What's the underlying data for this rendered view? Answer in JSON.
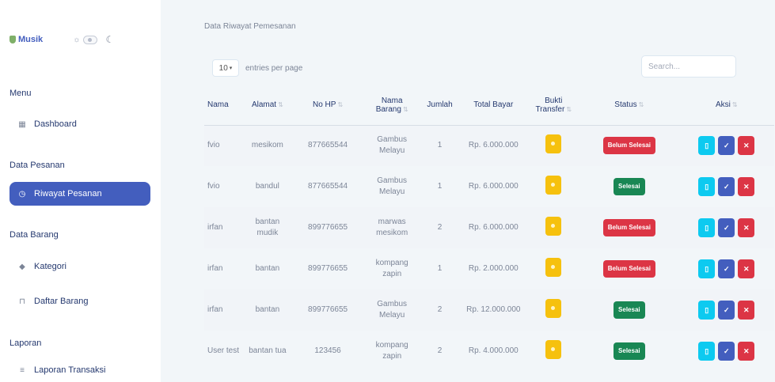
{
  "sidebar": {
    "logo_text": "Musik",
    "sections": {
      "menu": "Menu",
      "data_pesanan": "Data Pesanan",
      "data_barang": "Data Barang",
      "laporan": "Laporan"
    },
    "items": {
      "dashboard": "Dashboard",
      "riwayat_pesanan": "Riwayat Pesanan",
      "kategori": "Kategori",
      "daftar_barang": "Daftar Barang",
      "laporan_transaksi": "Laporan Transaksi"
    },
    "active_item": "riwayat_pesanan"
  },
  "main": {
    "title": "Data Riwayat Pemesanan",
    "per_page_value": "10",
    "per_page_label": "entries per page",
    "search_placeholder": "Search..."
  },
  "table": {
    "headers": {
      "nama": "Nama",
      "alamat": "Alamat",
      "no_hp": "No HP",
      "nama_barang": "Nama Barang",
      "jumlah": "Jumlah",
      "total_bayar": "Total Bayar",
      "bukti_transfer": "Bukti Transfer",
      "status": "Status",
      "aksi": "Aksi"
    },
    "rows": [
      {
        "nama": "fvio",
        "alamat": "mesikom",
        "no_hp": "877665544",
        "nama_barang": "Gambus Melayu",
        "jumlah": "1",
        "total_bayar": "Rp. 6.000.000",
        "status": "Belum Selesai"
      },
      {
        "nama": "fvio",
        "alamat": "bandul",
        "no_hp": "877665544",
        "nama_barang": "Gambus Melayu",
        "jumlah": "1",
        "total_bayar": "Rp. 6.000.000",
        "status": "Selesai"
      },
      {
        "nama": "irfan",
        "alamat": "bantan mudik",
        "no_hp": "899776655",
        "nama_barang": "marwas mesikom",
        "jumlah": "2",
        "total_bayar": "Rp. 6.000.000",
        "status": "Belum Selesai"
      },
      {
        "nama": "irfan",
        "alamat": "bantan",
        "no_hp": "899776655",
        "nama_barang": "kompang zapin",
        "jumlah": "1",
        "total_bayar": "Rp. 2.000.000",
        "status": "Belum Selesai"
      },
      {
        "nama": "irfan",
        "alamat": "bantan",
        "no_hp": "899776655",
        "nama_barang": "Gambus Melayu",
        "jumlah": "2",
        "total_bayar": "Rp. 12.000.000",
        "status": "Selesai"
      },
      {
        "nama": "User test",
        "alamat": "bantan tua",
        "no_hp": "123456",
        "nama_barang": "kompang zapin",
        "jumlah": "2",
        "total_bayar": "Rp. 4.000.000",
        "status": "Selesai"
      }
    ]
  },
  "colors": {
    "primary": "#435ebe",
    "info": "#0dcaf0",
    "danger": "#dc3545",
    "success": "#198754",
    "warning": "#f6c10e"
  },
  "icons": {
    "dashboard": "grid-icon",
    "riwayat_pesanan": "clock-icon",
    "kategori": "tag-icon",
    "daftar_barang": "trash-icon",
    "laporan_transaksi": "list-icon",
    "aksi_view": "file-icon",
    "aksi_confirm": "check-icon",
    "aksi_delete": "close-icon"
  }
}
